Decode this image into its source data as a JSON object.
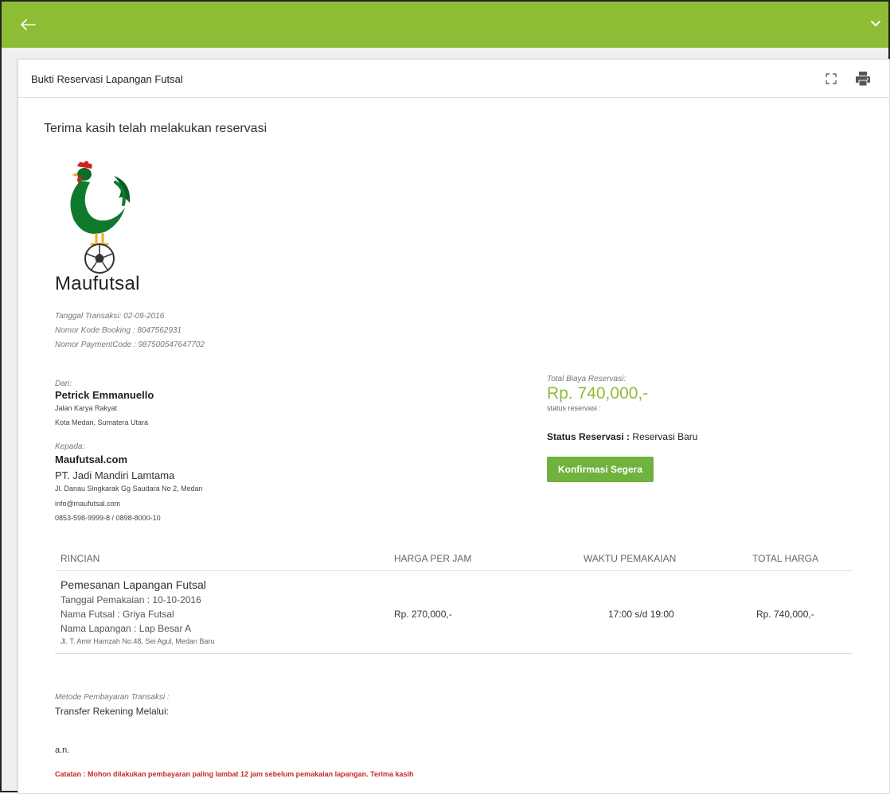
{
  "header": {
    "back_icon": "arrow-left-icon",
    "menu_icon": "chevron-down-icon",
    "bar_color": "#8dbd35"
  },
  "panel": {
    "title": "Bukti Reservasi Lapangan Futsal",
    "expand_icon": "fullscreen-icon",
    "print_icon": "print-icon"
  },
  "receipt": {
    "thanks": "Terima kasih telah melakukan reservasi",
    "brand": "Maufutsal",
    "transaction_date": "Tanggal Transaksi: 02-09-2016",
    "booking_code": "Nomor Kode Booking : 8047562931",
    "payment_code": "Nomor PaymentCode : 987500547647702"
  },
  "from": {
    "label": "Dari:",
    "name": "Petrick Emmanuello",
    "address1": "Jalan Karya Rakyat",
    "address2": "Kota Medan, Sumatera Utara"
  },
  "to": {
    "label": "Kepada:",
    "name": "Maufutsal.com",
    "company": "PT. Jadi Mandiri Lamtama",
    "address": "Jl. Danau Singkarak Gg Saudara No 2, Medan",
    "email": "info@maufutsal.com",
    "phone": "0853-598-9999-8 / 0898-8000-10"
  },
  "summary": {
    "total_label": "Total Biaya Reservasi:",
    "total_value": "Rp. 740,000,-",
    "status_small": "status reservasi :",
    "status_label": "Status Reservasi :",
    "status_value": "Reservasi Baru",
    "confirm_button": "Konfirmasi Segera",
    "accent_color": "#8dbd35",
    "button_color": "#6fb23d"
  },
  "table": {
    "headers": [
      "RINCIAN",
      "HARGA PER JAM",
      "WAKTU PEMAKAIAN",
      "TOTAL HARGA"
    ],
    "row": {
      "title": "Pemesanan Lapangan Futsal",
      "date": "Tanggal Pemakaian : 10-10-2016",
      "futsal": "Nama Futsal : Griya Futsal",
      "field": "Nama Lapangan : Lap Besar A",
      "address": "Jl. T. Amir Hamzah No.48, Sei Agul, Medan Baru",
      "price": "Rp. 270,000,-",
      "time": "17:00 s/d 19:00",
      "total": "Rp. 740,000,-"
    }
  },
  "payment": {
    "method_label": "Metode Pembayaran Transaksi :",
    "method_value": "Transfer Rekening Melalui:",
    "an": "a.n.",
    "note": "Catatan : Mohon dilakukan pembayaran paling lambat 12 jam sebelum pemakaian lapangan. Terima kasih",
    "note_color": "#c62828"
  }
}
